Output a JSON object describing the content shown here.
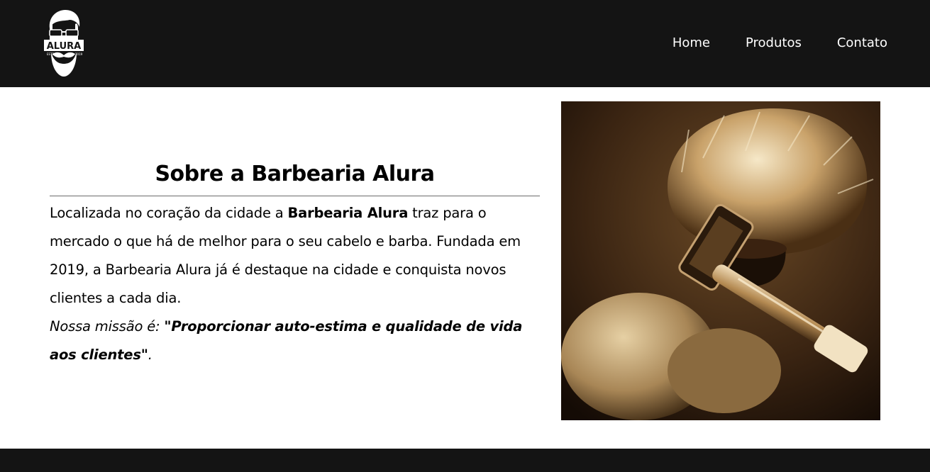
{
  "header": {
    "logo_text": "ALURA",
    "logo_est_left": "ESTD",
    "logo_est_right": "2019",
    "nav": [
      {
        "label": "Home"
      },
      {
        "label": "Produtos"
      },
      {
        "label": "Contato"
      }
    ]
  },
  "about": {
    "title": "Sobre a Barbearia Alura",
    "p1_a": "Localizada no coração da cidade a ",
    "p1_strong": "Barbearia Alura",
    "p1_b": " traz para o mercado o que há de melhor para o seu cabelo e barba. Fundada em 2019, a Barbearia Alura já é destaque na cidade e conquista novos clientes a cada dia.",
    "mission_label": "Nossa missão é: ",
    "mission_quote": "\"Proporcionar auto-estima e qualidade de vida aos clientes\"",
    "mission_end": "."
  },
  "colors": {
    "header_bg": "#141414",
    "footer_bg": "#141414",
    "nav_text": "#ffffff",
    "divider": "#6b6b6b"
  },
  "photo": {
    "subject": "shaving brush and safety razor, sepia"
  }
}
